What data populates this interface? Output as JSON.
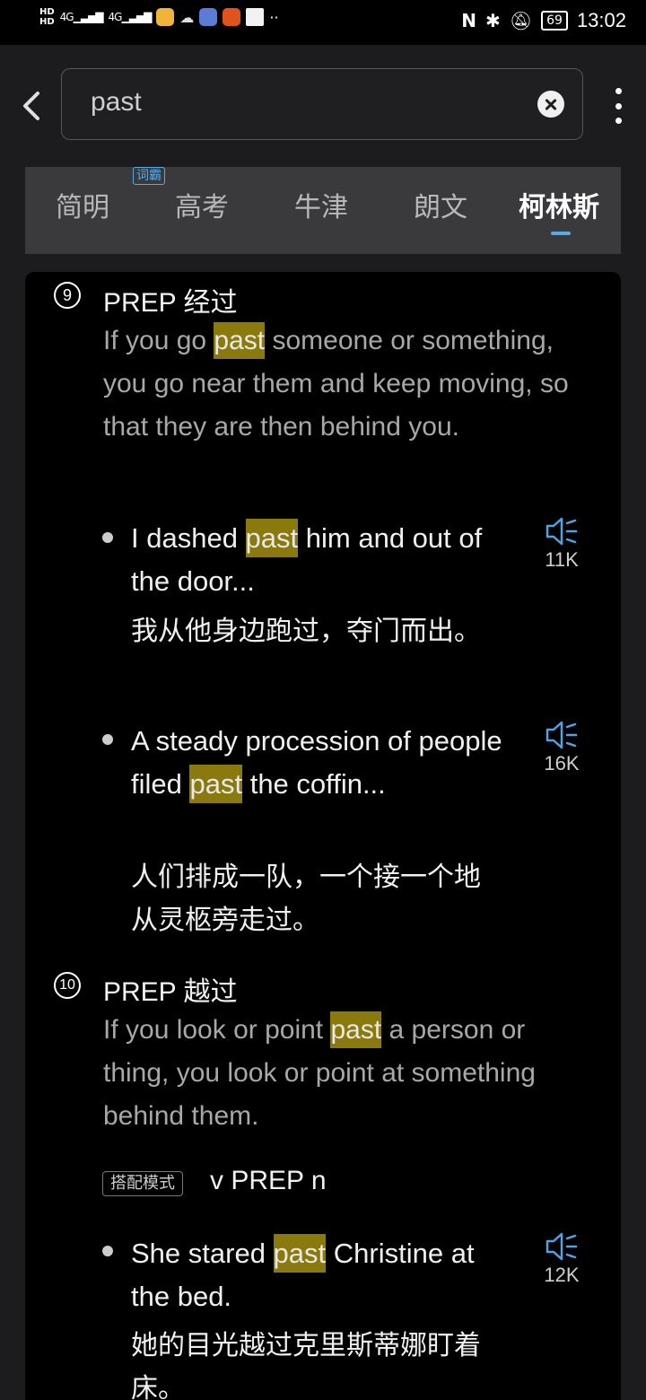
{
  "status": {
    "time": "13:02",
    "battery": "69",
    "hd": [
      "HD",
      "HD"
    ],
    "signal": [
      "4G",
      "4G"
    ]
  },
  "search": {
    "value": "past"
  },
  "tabs": [
    {
      "label": "简明"
    },
    {
      "label": "高考"
    },
    {
      "label": "牛津"
    },
    {
      "label": "朗文"
    },
    {
      "label": "柯林斯"
    }
  ],
  "tab_badge": "词霸",
  "senses": [
    {
      "number": "9",
      "pos": "PREP",
      "cn": "经过",
      "definition": [
        "If you go ",
        "past",
        " someone or something, you go near them and keep moving, so that they are then behind you."
      ],
      "examples": [
        {
          "en": [
            "I dashed ",
            "past",
            " him and out of the door..."
          ],
          "cn": "我从他身边跑过，夺门而出。",
          "plays": "11K"
        },
        {
          "en": [
            "A steady procession of people filed ",
            "past",
            " the coffin..."
          ],
          "cn": "人们排成一队，一个接一个地从灵柩旁走过。",
          "plays": "16K"
        }
      ]
    },
    {
      "number": "10",
      "pos": "PREP",
      "cn": "越过",
      "definition": [
        "If you look or point ",
        "past",
        " a person or thing, you look or point at something behind them."
      ],
      "pattern_label": "搭配模式",
      "pattern": "v PREP n",
      "examples": [
        {
          "en": [
            "She stared ",
            "past",
            " Christine at the bed."
          ],
          "cn": "她的目光越过克里斯蒂娜盯着床。",
          "plays": "12K"
        }
      ]
    }
  ],
  "colors": {
    "highlight": "#8a7a0e",
    "accent": "#5aa9e6",
    "background": "#000000"
  },
  "icons": [
    "back-arrow-icon",
    "clear-icon",
    "more-icon",
    "speaker-icon"
  ]
}
